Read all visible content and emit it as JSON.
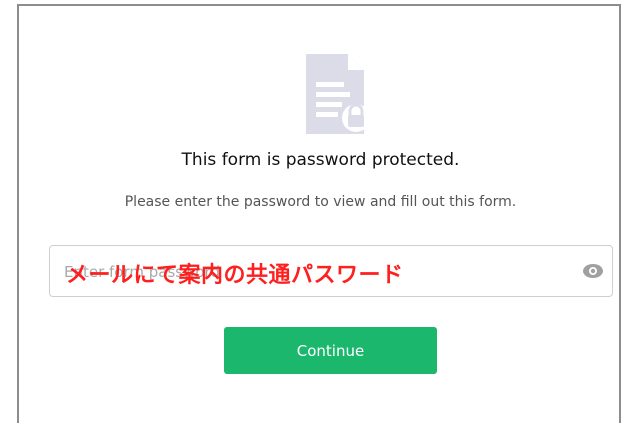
{
  "dialog": {
    "title": "This form is password protected.",
    "subtitle": "Please enter the password to view and fill out this form."
  },
  "password_field": {
    "placeholder": "Enter form password",
    "value": "",
    "reveal_icon": "eye-icon"
  },
  "annotation": {
    "text": "メールにて案内の共通パスワード",
    "color": "#ff1f1f"
  },
  "continue_button": {
    "label": "Continue",
    "color": "#1bb76d"
  },
  "icons": {
    "header": "locked-document-icon"
  }
}
